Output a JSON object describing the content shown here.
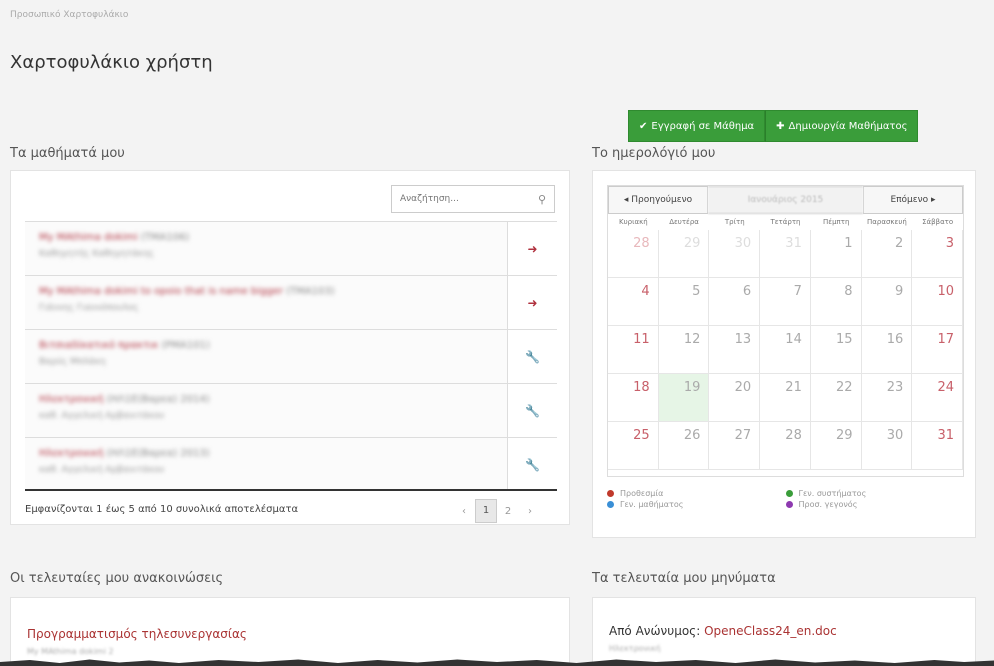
{
  "breadcrumb": "Προσωπικό Χαρτοφυλάκιο",
  "page_title": "Χαρτοφυλάκιο χρήστη",
  "actions": {
    "enroll_label": "Εγγραφή σε Μάθημα",
    "create_label": "Δημιουργία Μαθήματος",
    "enroll_icon": "check-icon",
    "create_icon": "plus-circle-icon"
  },
  "colors": {
    "accent_green": "#3a9d3a",
    "course_link": "#b0323f"
  },
  "courses": {
    "title": "Τα μαθήματά μου",
    "search_placeholder": "Αναζήτηση...",
    "rows": [
      {
        "title": "My MAthima dokimi",
        "code": "(TMA106)",
        "sub": "Καθηγητής Καθηγητάκης",
        "action": "sign-out-icon"
      },
      {
        "title": "My MAthima dokimi to opoio that is name bigger",
        "code": "(TMA103)",
        "sub": "Γιάννης Γιαννόπουλος",
        "action": "sign-out-icon"
      },
      {
        "title": "Βιτσιαδίκατικό πρακτικ",
        "code": "(PMA101)",
        "sub": "Βαρύς Μπλάκη",
        "action": "wrench-icon"
      },
      {
        "title": "Ηλεκτρονική",
        "code": "(ΗΛ1Ε(Βαρεα) 2014)",
        "sub": "καθ. Αγγελική Αρβανιτάκου",
        "action": "wrench-icon"
      },
      {
        "title": "Ηλεκτρονική",
        "code": "(ΗΛ1Ε(Βαρεα) 2013)",
        "sub": "καθ. Αγγελική Αρβανιτάκου",
        "action": "wrench-icon"
      }
    ],
    "results_text": "Εμφανίζονται 1 έως 5 από 10 συνολικά αποτελέσματα",
    "pages": [
      "‹",
      "1",
      "2",
      "›"
    ],
    "current_page": "1"
  },
  "calendar": {
    "title": "Το ημερολόγιό μου",
    "prev_label": "◂ Προηγούμενο",
    "next_label": "Επόμενο ▸",
    "month_label": "Ιανουάριος 2015",
    "weekdays": [
      "Κυριακή",
      "Δευτέρα",
      "Τρίτη",
      "Τετάρτη",
      "Πέμπτη",
      "Παρασκευή",
      "Σάββατο"
    ],
    "weeks": [
      [
        "28",
        "29",
        "30",
        "31",
        "1",
        "2",
        "3"
      ],
      [
        "4",
        "5",
        "6",
        "7",
        "8",
        "9",
        "10"
      ],
      [
        "11",
        "12",
        "13",
        "14",
        "15",
        "16",
        "17"
      ],
      [
        "18",
        "19",
        "20",
        "21",
        "22",
        "23",
        "24"
      ],
      [
        "25",
        "26",
        "27",
        "28",
        "29",
        "30",
        "31"
      ]
    ],
    "today": "19",
    "legend": [
      {
        "label": "Προθεσμία",
        "color": "#c0392b"
      },
      {
        "label": "Γεν. συστήματος",
        "color": "#3a9d3a"
      },
      {
        "label": "Γεν. μαθήματος",
        "color": "#3a8fd6"
      },
      {
        "label": "Προσ. γεγονός",
        "color": "#8e3ab0"
      }
    ]
  },
  "announcements": {
    "title": "Οι τελευταίες μου ανακοινώσεις",
    "item_title": "Προγραμματισμός τηλεσυνεργασίας",
    "item_sub": "My MAthima dokimi 2"
  },
  "messages": {
    "title": "Τα τελευταία μου μηνύματα",
    "prefix": "Από Ανώνυμος:",
    "file": "OpeneClass24_en.doc",
    "sub": "Ηλεκτρονική"
  }
}
